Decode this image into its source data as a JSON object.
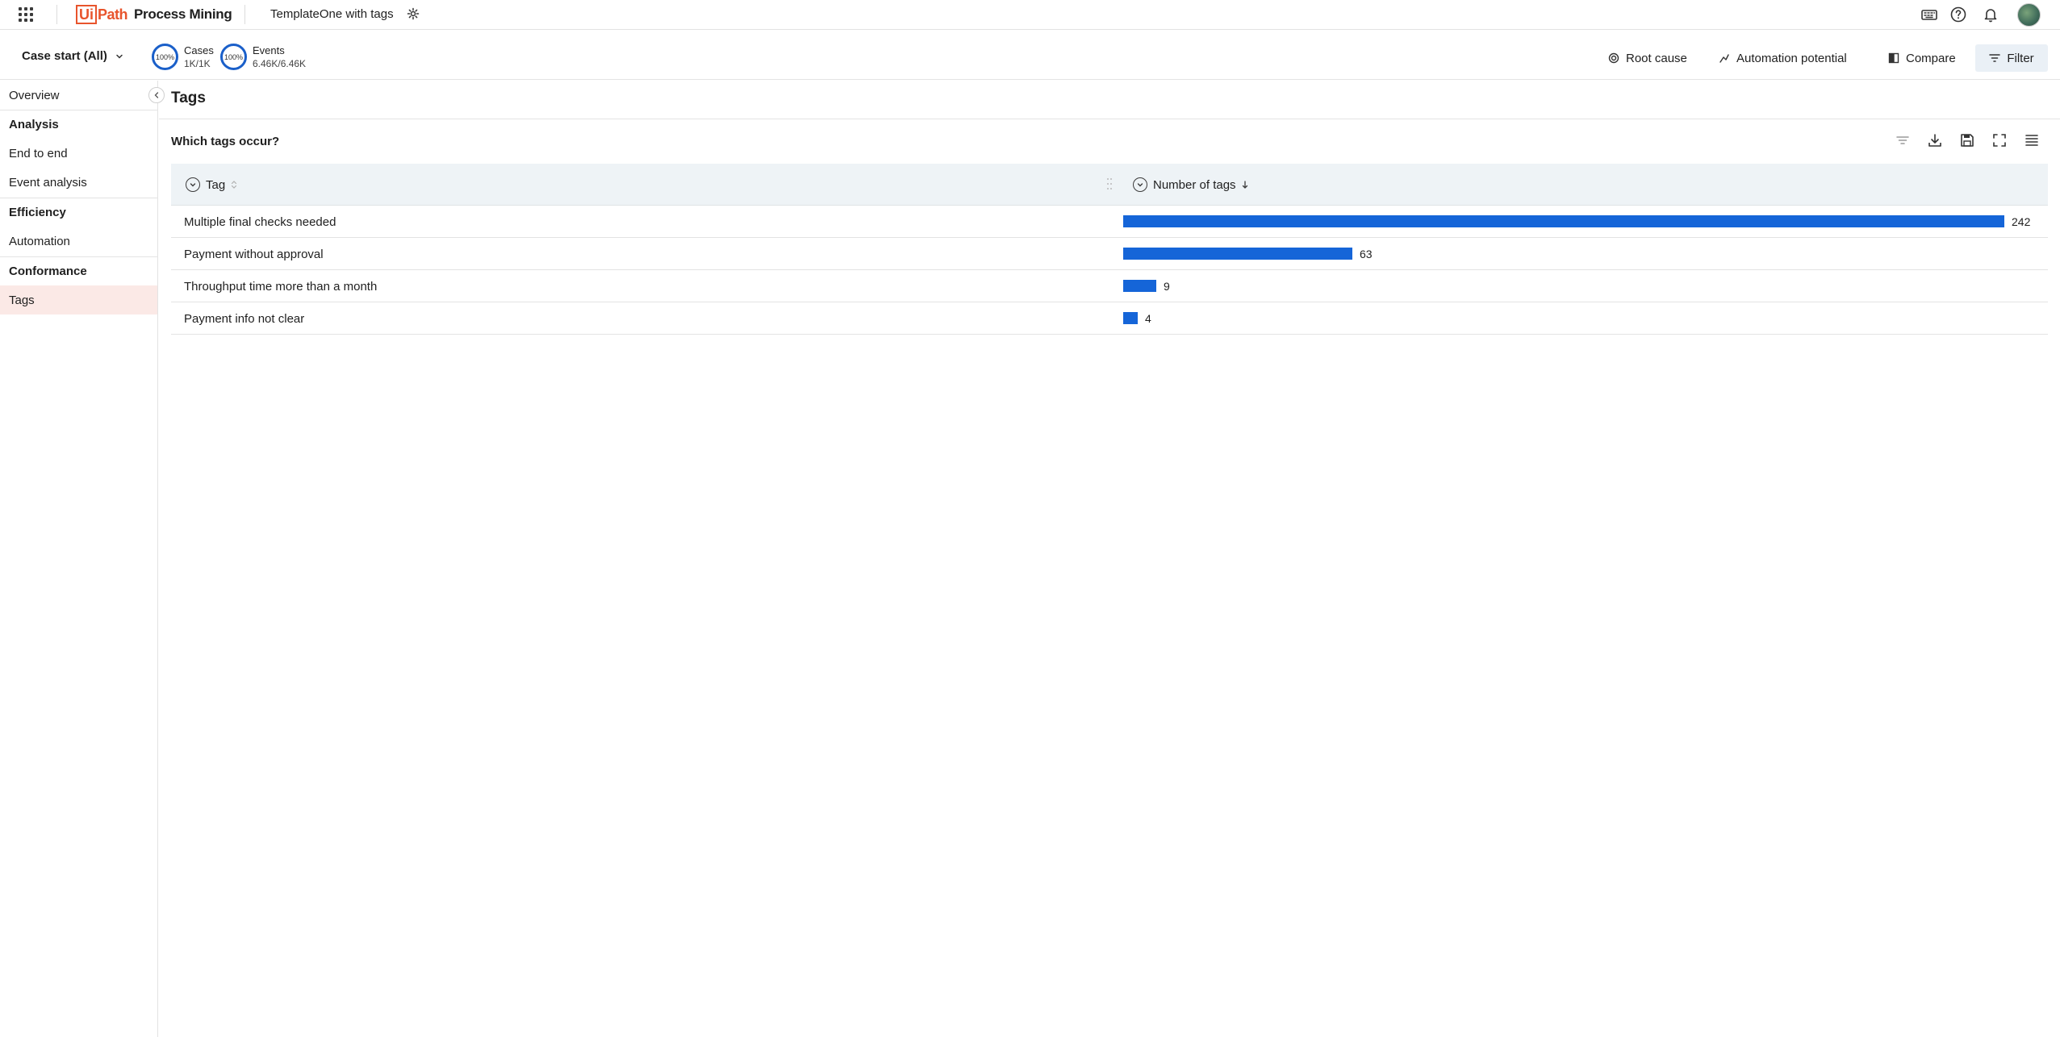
{
  "topbar": {
    "logo_box": "Ui",
    "logo_path": "Path",
    "product": "Process Mining",
    "app_title": "TemplateOne with tags"
  },
  "subbar": {
    "case_start": "Case start (All)",
    "metrics": [
      {
        "ring": "100%",
        "label": "Cases",
        "value": "1K/1K"
      },
      {
        "ring": "100%",
        "label": "Events",
        "value": "6.46K/6.46K"
      }
    ],
    "actions": {
      "root_cause": "Root cause",
      "automation_potential": "Automation potential",
      "compare": "Compare",
      "filter": "Filter"
    }
  },
  "sidebar": {
    "overview": "Overview",
    "sections": [
      {
        "title": "Analysis",
        "items": [
          "End to end",
          "Event analysis"
        ]
      },
      {
        "title": "Efficiency",
        "items": [
          "Automation"
        ]
      },
      {
        "title": "Conformance",
        "items": [
          "Tags"
        ]
      }
    ],
    "active_item": "Tags"
  },
  "main": {
    "page_title": "Tags",
    "card_title": "Which tags occur?",
    "columns": {
      "tag": "Tag",
      "count": "Number of tags"
    },
    "sort": {
      "column": "Number of tags",
      "direction": "descending"
    },
    "bar_color": "#1565d8"
  },
  "chart_data": {
    "type": "table",
    "categories": [
      "Multiple final checks needed",
      "Payment without approval",
      "Throughput time more than a month",
      "Payment info not clear"
    ],
    "values": [
      242,
      63,
      9,
      4
    ],
    "labels": [
      "242",
      "63",
      "9",
      "4"
    ]
  }
}
